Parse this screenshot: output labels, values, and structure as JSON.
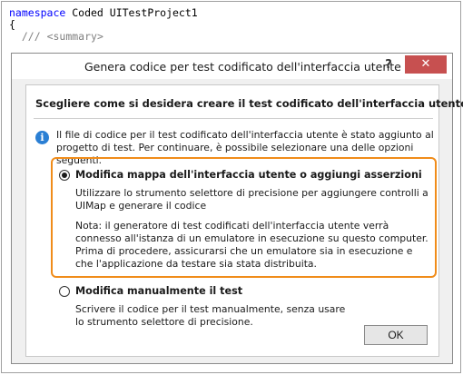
{
  "code": {
    "line1_keyword": "namespace",
    "line1_rest": " Coded UITestProject1",
    "line2": "{",
    "line3_comment": "/// ",
    "line3_tag": "<summary>"
  },
  "dialog": {
    "title": "Genera codice per test codificato dell'interfaccia utente",
    "help_label": "?",
    "close_label": "✕",
    "heading": "Scegliere come si desidera creare il test codificato dell'interfaccia utente",
    "info_icon_glyph": "i",
    "info_text": "Il file di codice per il test codificato dell'interfaccia utente è stato aggiunto al progetto di test. Per continuare, è possibile selezionare una delle opzioni seguenti.",
    "option1": {
      "label": "Modifica mappa dell'interfaccia utente o aggiungi asserzioni",
      "desc1": "Utilizzare lo strumento selettore di precisione per aggiungere controlli a UIMap e generare il codice",
      "desc2": "Nota: il generatore di test codificati dell'interfaccia utente verrà connesso all'istanza di un emulatore in esecuzione su questo computer.  Prima di procedere, assicurarsi che un emulatore sia in esecuzione e che l'applicazione da testare sia stata distribuita.",
      "checked": true
    },
    "option2": {
      "label": "Modifica manualmente il test",
      "desc": "Scrivere il codice per il test manualmente, senza usare lo strumento selettore di precisione.",
      "checked": false
    },
    "ok_label": "OK"
  },
  "colors": {
    "highlight": "#f08c1a",
    "close": "#c75050",
    "info": "#2a7fd4",
    "keyword": "#0000ff"
  }
}
